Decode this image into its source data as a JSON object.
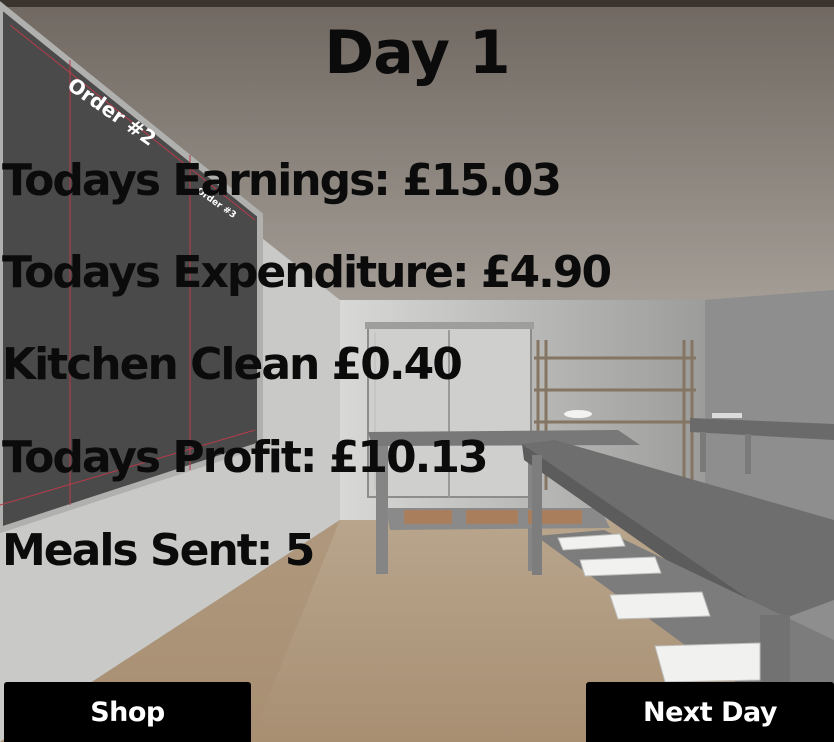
{
  "header": {
    "day_label": "Day 1"
  },
  "stats": {
    "earnings": "Todays Earnings: £15.03",
    "expenditure": "Todays Expenditure: £4.90",
    "kitchen_clean": "Kitchen Clean £0.40",
    "profit": "Todays Profit: £10.13",
    "meals_sent": "Meals Sent: 5"
  },
  "buttons": {
    "shop": "Shop",
    "next_day": "Next Day"
  },
  "board": {
    "order_label": "Order #2",
    "order_label_small": "Order #3"
  },
  "colors": {
    "text": "#0b0b0b",
    "button_bg": "#000000",
    "button_text": "#ffffff"
  }
}
